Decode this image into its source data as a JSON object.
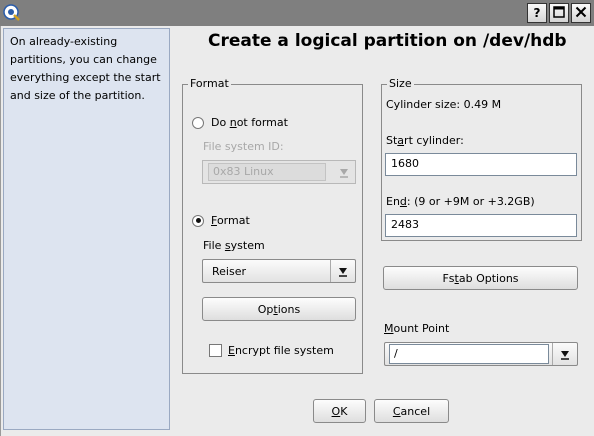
{
  "window": {
    "title": ""
  },
  "titlebar_buttons": {
    "help": "?",
    "maximize": "☐",
    "close": "✕"
  },
  "help_text": "On already-existing partitions, you can change everything except the start and size of the partition.",
  "heading": "Create a logical partition on /dev/hdb",
  "format_group": {
    "legend": "Format",
    "do_not_format": {
      "pre": "Do ",
      "mnemonic": "n",
      "post": "ot format",
      "selected": false
    },
    "file_system_id": {
      "label": "File system ID:",
      "value": "0x83 Linux",
      "enabled": false
    },
    "format": {
      "pre": "",
      "mnemonic": "F",
      "post": "ormat",
      "selected": true
    },
    "file_system": {
      "pre": "File ",
      "mnemonic": "s",
      "post": "ystem",
      "value": "Reiser"
    },
    "options_button": {
      "pre": "Op",
      "mnemonic": "t",
      "post": "ions"
    },
    "encrypt": {
      "pre": "",
      "mnemonic": "E",
      "post": "ncrypt file system",
      "checked": false
    }
  },
  "size_group": {
    "legend": "Size",
    "cylinder_size": "Cylinder size: 0.49 M",
    "start": {
      "pre": "St",
      "mnemonic": "a",
      "post": "rt cylinder:",
      "value": "1680"
    },
    "end": {
      "pre": "En",
      "mnemonic": "d",
      "post": ":  (9 or +9M or +3.2GB)",
      "value": "2483"
    }
  },
  "fstab_button": {
    "pre": "Fs",
    "mnemonic": "t",
    "post": "ab Options"
  },
  "mount_point": {
    "pre": "",
    "mnemonic": "M",
    "post": "ount Point",
    "value": "/"
  },
  "ok_button": {
    "pre": "",
    "mnemonic": "O",
    "post": "K"
  },
  "cancel_button": {
    "pre": "",
    "mnemonic": "C",
    "post": "ancel"
  },
  "icons": {
    "app": "yast-partitioner-icon",
    "combo_arrow": "combo-arrow-icon"
  }
}
